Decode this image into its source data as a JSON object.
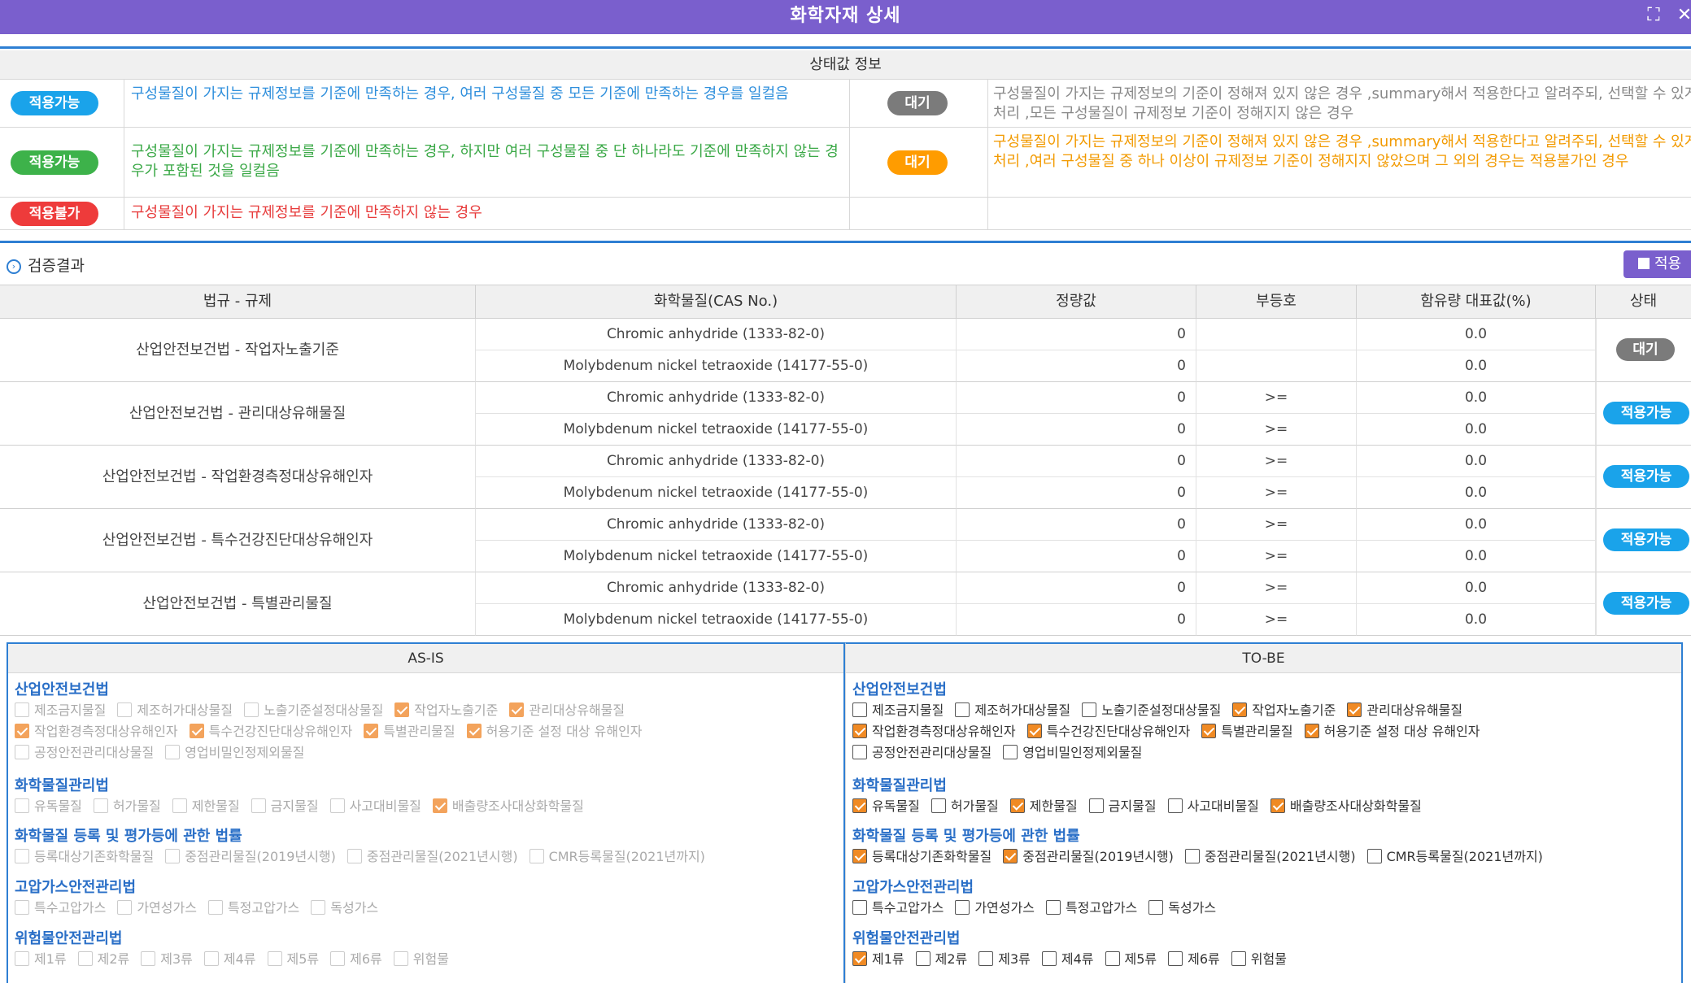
{
  "window": {
    "title": "화학자재 상세"
  },
  "status_info": {
    "heading": "상태값 정보",
    "rows": [
      {
        "left_badge": "적용가능",
        "left_desc": "구성물질이 가지는 규제정보를 기준에 만족하는 경우, 여러 구성물질 중 모든 기준에 만족하는 경우를 일컬음",
        "right_badge": "대기",
        "right_desc": "구성물질이 가지는 규제정보의 기준이 정해져 있지 않은 경우 ,summary해서 적용한다고 알려주되, 선택할 수 있게 처리 ,모든 구성물질이 규제정보 기준이 정해지지 않은 경우"
      },
      {
        "left_badge": "적용가능",
        "left_desc": "구성물질이 가지는 규제정보를 기준에 만족하는 경우, 하지만 여러 구성물질 중 단 하나라도 기준에 만족하지 않는 경우가 포함된 것을 일컬음",
        "right_badge": "대기",
        "right_desc": "구성물질이 가지는 규제정보의 기준이 정해져 있지 않은 경우 ,summary해서 적용한다고 알려주되, 선택할 수 있게 처리 ,여러 구성물질 중 하나 이상이 규제정보 기준이 정해지지 않았으며 그 외의 경우는 적용불가인 경우"
      },
      {
        "left_badge": "적용불가",
        "left_desc": "구성물질이 가지는 규제정보를 기준에 만족하지 않는 경우"
      }
    ]
  },
  "verification": {
    "title": "검증결과",
    "apply_button": "적용",
    "columns": [
      "법규 - 규제",
      "화학물질(CAS No.)",
      "정량값",
      "부등호",
      "함유량 대표값(%)",
      "상태"
    ],
    "groups": [
      {
        "law": "산업안전보건법 - 작업자노출기준",
        "status": "대기",
        "rows": [
          {
            "chemical": "Chromic anhydride (1333-82-0)",
            "quantity": "0",
            "operator": "",
            "content": "0.0"
          },
          {
            "chemical": "Molybdenum nickel tetraoxide (14177-55-0)",
            "quantity": "0",
            "operator": "",
            "content": "0.0"
          }
        ]
      },
      {
        "law": "산업안전보건법 - 관리대상유해물질",
        "status": "적용가능",
        "rows": [
          {
            "chemical": "Chromic anhydride (1333-82-0)",
            "quantity": "0",
            "operator": ">=",
            "content": "0.0"
          },
          {
            "chemical": "Molybdenum nickel tetraoxide (14177-55-0)",
            "quantity": "0",
            "operator": ">=",
            "content": "0.0"
          }
        ]
      },
      {
        "law": "산업안전보건법 - 작업환경측정대상유해인자",
        "status": "적용가능",
        "rows": [
          {
            "chemical": "Chromic anhydride (1333-82-0)",
            "quantity": "0",
            "operator": ">=",
            "content": "0.0"
          },
          {
            "chemical": "Molybdenum nickel tetraoxide (14177-55-0)",
            "quantity": "0",
            "operator": ">=",
            "content": "0.0"
          }
        ]
      },
      {
        "law": "산업안전보건법 - 특수건강진단대상유해인자",
        "status": "적용가능",
        "rows": [
          {
            "chemical": "Chromic anhydride (1333-82-0)",
            "quantity": "0",
            "operator": ">=",
            "content": "0.0"
          },
          {
            "chemical": "Molybdenum nickel tetraoxide (14177-55-0)",
            "quantity": "0",
            "operator": ">=",
            "content": "0.0"
          }
        ]
      },
      {
        "law": "산업안전보건법 - 특별관리물질",
        "status": "적용가능",
        "rows": [
          {
            "chemical": "Chromic anhydride (1333-82-0)",
            "quantity": "0",
            "operator": ">=",
            "content": "0.0"
          },
          {
            "chemical": "Molybdenum nickel tetraoxide (14177-55-0)",
            "quantity": "0",
            "operator": ">=",
            "content": "0.0"
          }
        ]
      }
    ]
  },
  "asis": {
    "title": "AS-IS",
    "categories": [
      {
        "name": "산업안전보건법",
        "lines": [
          [
            {
              "label": "제조금지물질",
              "checked": false
            },
            {
              "label": "제조허가대상물질",
              "checked": false
            },
            {
              "label": "노출기준설정대상물질",
              "checked": false
            },
            {
              "label": "작업자노출기준",
              "checked": true
            },
            {
              "label": "관리대상유해물질",
              "checked": true
            }
          ],
          [
            {
              "label": "작업환경측정대상유해인자",
              "checked": true
            },
            {
              "label": "특수건강진단대상유해인자",
              "checked": true
            },
            {
              "label": "특별관리물질",
              "checked": true
            },
            {
              "label": "허용기준 설정 대상 유해인자",
              "checked": true
            }
          ],
          [
            {
              "label": "공정안전관리대상물질",
              "checked": false
            },
            {
              "label": "영업비밀인정제외물질",
              "checked": false
            }
          ]
        ]
      },
      {
        "name": "화학물질관리법",
        "lines": [
          [
            {
              "label": "유독물질",
              "checked": false
            },
            {
              "label": "허가물질",
              "checked": false
            },
            {
              "label": "제한물질",
              "checked": false
            },
            {
              "label": "금지물질",
              "checked": false
            },
            {
              "label": "사고대비물질",
              "checked": false
            },
            {
              "label": "배출량조사대상화학물질",
              "checked": true
            }
          ]
        ]
      },
      {
        "name": "화학물질 등록 및 평가등에 관한 법률",
        "lines": [
          [
            {
              "label": "등록대상기존화학물질",
              "checked": false
            },
            {
              "label": "중점관리물질(2019년시행)",
              "checked": false
            },
            {
              "label": "중점관리물질(2021년시행)",
              "checked": false
            },
            {
              "label": "CMR등록물질(2021년까지)",
              "checked": false
            }
          ]
        ]
      },
      {
        "name": "고압가스안전관리법",
        "lines": [
          [
            {
              "label": "특수고압가스",
              "checked": false
            },
            {
              "label": "가연성가스",
              "checked": false
            },
            {
              "label": "특정고압가스",
              "checked": false
            },
            {
              "label": "독성가스",
              "checked": false
            }
          ]
        ]
      },
      {
        "name": "위험물안전관리법",
        "lines": [
          [
            {
              "label": "제1류",
              "checked": false
            },
            {
              "label": "제2류",
              "checked": false
            },
            {
              "label": "제3류",
              "checked": false
            },
            {
              "label": "제4류",
              "checked": false
            },
            {
              "label": "제5류",
              "checked": false
            },
            {
              "label": "제6류",
              "checked": false
            },
            {
              "label": "위험물",
              "checked": false
            }
          ]
        ]
      }
    ]
  },
  "tobe": {
    "title": "TO-BE",
    "categories": [
      {
        "name": "산업안전보건법",
        "lines": [
          [
            {
              "label": "제조금지물질",
              "checked": false
            },
            {
              "label": "제조허가대상물질",
              "checked": false
            },
            {
              "label": "노출기준설정대상물질",
              "checked": false
            },
            {
              "label": "작업자노출기준",
              "checked": true
            },
            {
              "label": "관리대상유해물질",
              "checked": true
            }
          ],
          [
            {
              "label": "작업환경측정대상유해인자",
              "checked": true
            },
            {
              "label": "특수건강진단대상유해인자",
              "checked": true
            },
            {
              "label": "특별관리물질",
              "checked": true
            },
            {
              "label": "허용기준 설정 대상 유해인자",
              "checked": true
            }
          ],
          [
            {
              "label": "공정안전관리대상물질",
              "checked": false
            },
            {
              "label": "영업비밀인정제외물질",
              "checked": false
            }
          ]
        ]
      },
      {
        "name": "화학물질관리법",
        "lines": [
          [
            {
              "label": "유독물질",
              "checked": true
            },
            {
              "label": "허가물질",
              "checked": false
            },
            {
              "label": "제한물질",
              "checked": true
            },
            {
              "label": "금지물질",
              "checked": false
            },
            {
              "label": "사고대비물질",
              "checked": false
            },
            {
              "label": "배출량조사대상화학물질",
              "checked": true
            }
          ]
        ]
      },
      {
        "name": "화학물질 등록 및 평가등에 관한 법률",
        "lines": [
          [
            {
              "label": "등록대상기존화학물질",
              "checked": true
            },
            {
              "label": "중점관리물질(2019년시행)",
              "checked": true
            },
            {
              "label": "중점관리물질(2021년시행)",
              "checked": false
            },
            {
              "label": "CMR등록물질(2021년까지)",
              "checked": false
            }
          ]
        ]
      },
      {
        "name": "고압가스안전관리법",
        "lines": [
          [
            {
              "label": "특수고압가스",
              "checked": false
            },
            {
              "label": "가연성가스",
              "checked": false
            },
            {
              "label": "특정고압가스",
              "checked": false
            },
            {
              "label": "독성가스",
              "checked": false
            }
          ]
        ]
      },
      {
        "name": "위험물안전관리법",
        "lines": [
          [
            {
              "label": "제1류",
              "checked": true
            },
            {
              "label": "제2류",
              "checked": false
            },
            {
              "label": "제3류",
              "checked": false
            },
            {
              "label": "제4류",
              "checked": false
            },
            {
              "label": "제5류",
              "checked": false
            },
            {
              "label": "제6류",
              "checked": false
            },
            {
              "label": "위험물",
              "checked": false
            }
          ]
        ]
      }
    ]
  }
}
